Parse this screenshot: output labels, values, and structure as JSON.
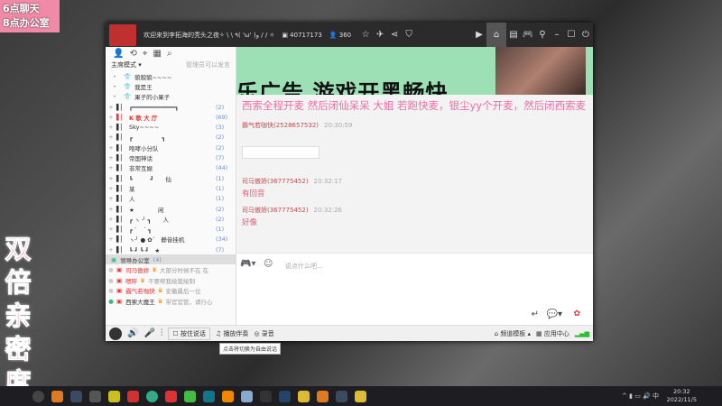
{
  "overlay": {
    "badge_line1": "6点聊天",
    "badge_line2": "8点办公室",
    "big_text": "双倍亲密度"
  },
  "titlebar": {
    "channel_title": "欢迎来到李拓海的秃头之夜✧ \\ \\ ٩( 'ω' )و / / ✧",
    "channel_id": "40717173",
    "online_count": "360"
  },
  "sidebar": {
    "mode": "主席模式 ▾",
    "mode_note": "管理员可以发言",
    "top_members": [
      "貌貌貌~~~~",
      "我是王",
      "果子的小果子"
    ],
    "channels": [
      {
        "name": "┏━━━━━━━━━━━━┓",
        "count": "(2)"
      },
      {
        "name": "K 歌 大 厅",
        "count": "(69)"
      },
      {
        "name": "Sky~~~~",
        "count": "(3)"
      },
      {
        "name": "┏　　　　　┓",
        "count": "(2)"
      },
      {
        "name": "咆哮小分队",
        "count": "(2)"
      },
      {
        "name": "帝国神话",
        "count": "(7)"
      },
      {
        "name": "非常互娱",
        "count": "(44)"
      },
      {
        "name": "┗　　　┛　　仙",
        "count": "(1)"
      },
      {
        "name": "某",
        "count": "(1)"
      },
      {
        "name": "人",
        "count": "(1)"
      },
      {
        "name": "★　　　　闲",
        "count": "(2)"
      },
      {
        "name": "┏ ヽ ╯ ┓　　人",
        "count": "(2)"
      },
      {
        "name": "┏ ˋ　ˊ ┓",
        "count": "(1)"
      },
      {
        "name": "ヽ╯ ● ✿ˊ　静音挂机",
        "count": "(34)"
      },
      {
        "name": "┗ ┛ ┗ ┛　★",
        "count": "(7)"
      }
    ],
    "office": {
      "name": "领导办公室",
      "count": "(4)"
    },
    "office_members": [
      {
        "name": "司马傲娇",
        "note": "大部分时候不在 在"
      },
      {
        "name": "嗯呼",
        "note": "不要帮我绘我绘制"
      },
      {
        "name": "霸气若咖快",
        "note": "安徽最后一位"
      },
      {
        "name": "西索大魔王",
        "note": "带官官管，请行心"
      }
    ]
  },
  "chat": {
    "pinned": "西索全程开麦 然后闭仙呆呆 大姐 若跑快麦，银尘yy个开麦，然后闭西索麦",
    "messages": [
      {
        "user": "霸气若咖快(2528657532)",
        "time": "20:30:59",
        "text": ""
      },
      {
        "user": "司马傲娇(367775452)",
        "time": "20:32:17",
        "text": "有回音"
      },
      {
        "user": "司马傲娇(367775452)",
        "time": "20:32:26",
        "text": "好像"
      }
    ]
  },
  "banner": {
    "text": "乐广告 游戏开黑畅快"
  },
  "input": {
    "placeholder": "说点什么吧..."
  },
  "bottombar": {
    "ptt": "按住说话",
    "music": "播放伴奏",
    "record": "录音",
    "template": "频道模板 ▴",
    "apps": "应用中心"
  },
  "tooltip": "点击将切换为自由说话",
  "taskbar": {
    "time": "20:32",
    "date": "2022/11/5",
    "ime": "中"
  }
}
